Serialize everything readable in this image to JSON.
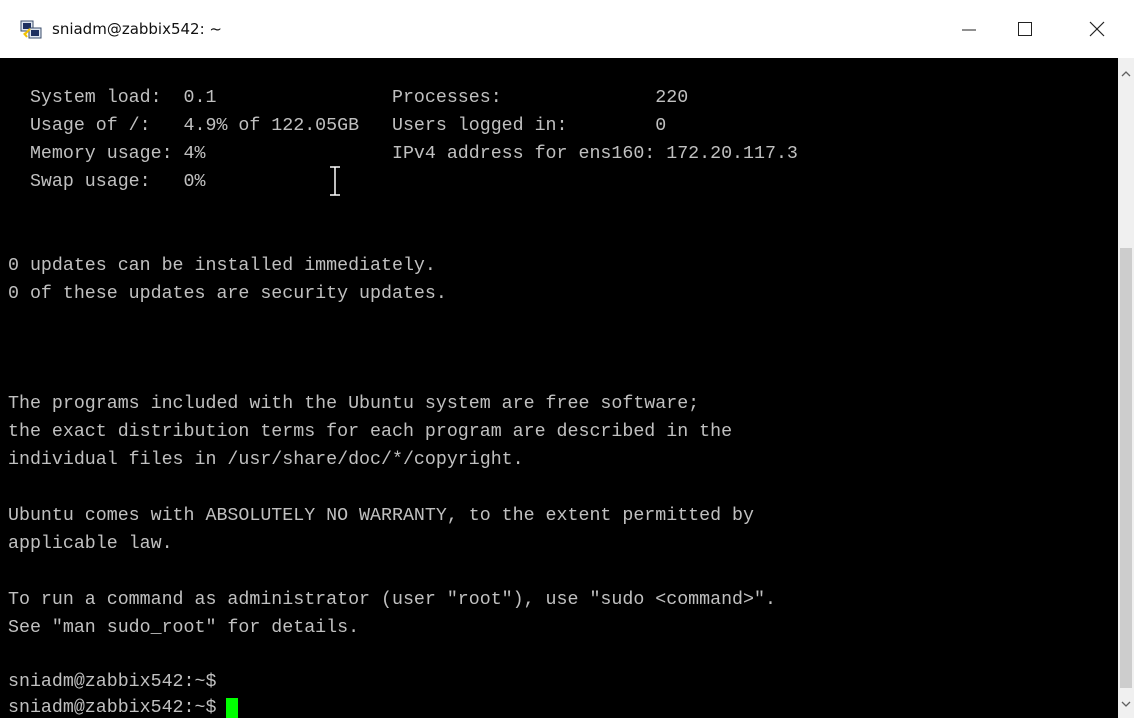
{
  "window": {
    "title": "sniadm@zabbix542: ~",
    "app_icon": "putty-icon",
    "buttons": {
      "minimize": "minimize-icon",
      "maximize": "maximize-icon",
      "close": "close-icon"
    }
  },
  "terminal": {
    "lines": [
      "  System load:  0.1                Processes:              220",
      "  Usage of /:   4.9% of 122.05GB   Users logged in:        0",
      "  Memory usage: 4%                 IPv4 address for ens160: 172.20.117.3",
      "  Swap usage:   0%",
      "0 updates can be installed immediately.",
      "0 of these updates are security updates.",
      "The programs included with the Ubuntu system are free software;",
      "the exact distribution terms for each program are described in the",
      "individual files in /usr/share/doc/*/copyright.",
      "Ubuntu comes with ABSOLUTELY NO WARRANTY, to the extent permitted by",
      "applicable law.",
      "To run a command as administrator (user \"root\"), use \"sudo <command>\".",
      "See \"man sudo_root\" for details.",
      "sniadm@zabbix542:~$",
      "sniadm@zabbix542:~$"
    ],
    "colors": {
      "background": "#000000",
      "text": "#c0c0c0",
      "cursor": "#00ff00"
    }
  },
  "scrollbar": {
    "up_icon": "scroll-up-icon",
    "down_icon": "scroll-down-icon"
  }
}
